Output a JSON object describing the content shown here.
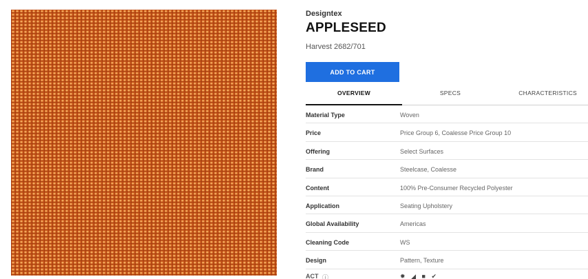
{
  "product": {
    "brand": "Designtex",
    "title": "APPLESEED",
    "colorway": "Harvest 2682/701",
    "add_to_cart_label": "ADD TO CART",
    "swatch_colors": {
      "base": "#c8561a",
      "highlight": "#f6c27a"
    }
  },
  "tabs": [
    {
      "label": "OVERVIEW",
      "active": true
    },
    {
      "label": "SPECS",
      "active": false
    },
    {
      "label": "CHARACTERISTICS",
      "active": false
    }
  ],
  "specs": [
    {
      "label": "Material Type",
      "value": "Woven"
    },
    {
      "label": "Price",
      "value": "Price Group 6, Coalesse Price Group 10"
    },
    {
      "label": "Offering",
      "value": "Select Surfaces"
    },
    {
      "label": "Brand",
      "value": "Steelcase, Coalesse"
    },
    {
      "label": "Content",
      "value": "100% Pre-Consumer Recycled Polyester"
    },
    {
      "label": "Application",
      "value": "Seating Upholstery"
    },
    {
      "label": "Global Availability",
      "value": "Americas"
    },
    {
      "label": "Cleaning Code",
      "value": "WS"
    },
    {
      "label": "Design",
      "value": "Pattern, Texture"
    }
  ],
  "act": {
    "label": "ACT",
    "info_icon": "ⓘ",
    "icons": [
      {
        "name": "fire-icon",
        "glyph": "✹"
      },
      {
        "name": "abrasion-icon",
        "glyph": "◢"
      },
      {
        "name": "colorfastness-icon",
        "glyph": "■"
      },
      {
        "name": "physical-properties-icon",
        "glyph": "✔"
      }
    ],
    "accent_color": "#1f6fe0"
  }
}
